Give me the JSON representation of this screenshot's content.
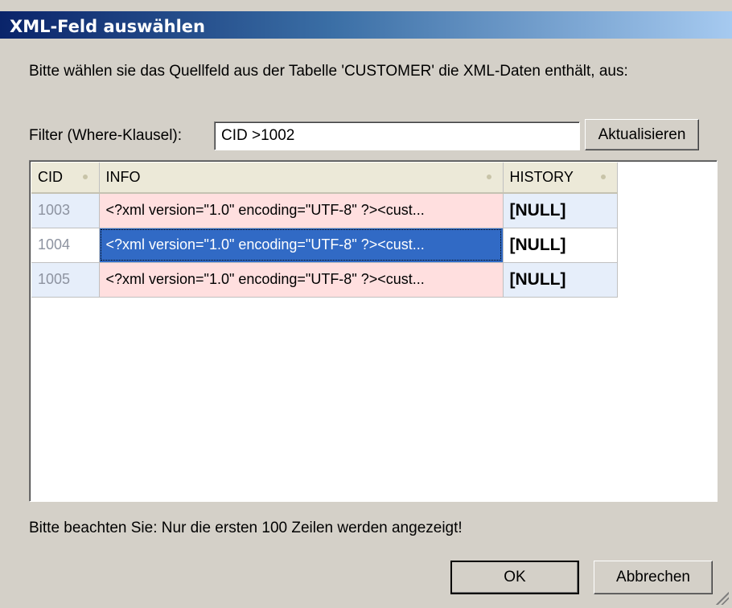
{
  "window": {
    "title": "XML-Feld auswählen"
  },
  "prompt": "Bitte wählen sie das Quellfeld aus der Tabelle 'CUSTOMER' die XML-Daten enthält, aus:",
  "filter": {
    "label": "Filter (Where-Klausel):",
    "value": "CID >1002",
    "refresh_label": "Aktualisieren"
  },
  "grid": {
    "columns": [
      "CID",
      "INFO",
      "HISTORY"
    ],
    "rows": [
      {
        "cid": "1003",
        "info": "<?xml version=\"1.0\" encoding=\"UTF-8\" ?><cust...",
        "history": "[NULL]"
      },
      {
        "cid": "1004",
        "info": "<?xml version=\"1.0\" encoding=\"UTF-8\" ?><cust...",
        "history": "[NULL]"
      },
      {
        "cid": "1005",
        "info": "<?xml version=\"1.0\" encoding=\"UTF-8\" ?><cust...",
        "history": "[NULL]"
      }
    ],
    "selected_row": 1
  },
  "note": "Bitte beachten Sie: Nur die ersten 100 Zeilen werden angezeigt!",
  "buttons": {
    "ok": "OK",
    "cancel": "Abbrechen"
  },
  "colors": {
    "selection": "#316ac5",
    "info_cell": "#ffdfdf",
    "alt_row": "#e6eefa"
  }
}
